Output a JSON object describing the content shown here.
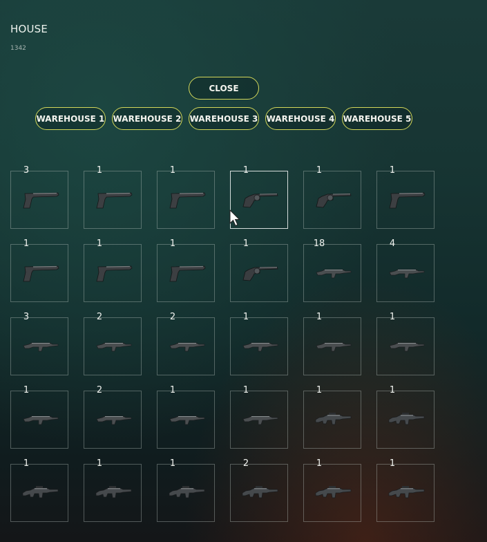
{
  "header": {
    "title": "HOUSE",
    "subtitle": "1342"
  },
  "buttons": {
    "close": "CLOSE",
    "warehouses": [
      "WAREHOUSE 1",
      "WAREHOUSE 2",
      "WAREHOUSE 3",
      "WAREHOUSE 4",
      "WAREHOUSE 5"
    ]
  },
  "accent_color": "#d4d85a",
  "inventory": {
    "slots": [
      {
        "count": "3",
        "icon": "pistol-icon"
      },
      {
        "count": "1",
        "icon": "pistol-icon"
      },
      {
        "count": "1",
        "icon": "pistol-icon"
      },
      {
        "count": "1",
        "icon": "revolver-icon"
      },
      {
        "count": "1",
        "icon": "revolver-icon"
      },
      {
        "count": "1",
        "icon": "pistol-icon"
      },
      {
        "count": "1",
        "icon": "pistol-icon"
      },
      {
        "count": "1",
        "icon": "pistol-icon"
      },
      {
        "count": "1",
        "icon": "pistol-icon"
      },
      {
        "count": "1",
        "icon": "revolver-icon"
      },
      {
        "count": "18",
        "icon": "smg-icon"
      },
      {
        "count": "4",
        "icon": "smg-icon"
      },
      {
        "count": "3",
        "icon": "smg-icon"
      },
      {
        "count": "2",
        "icon": "smg-icon"
      },
      {
        "count": "2",
        "icon": "smg-icon"
      },
      {
        "count": "1",
        "icon": "smg-icon"
      },
      {
        "count": "1",
        "icon": "smg-icon"
      },
      {
        "count": "1",
        "icon": "smg-icon"
      },
      {
        "count": "1",
        "icon": "smg-icon"
      },
      {
        "count": "2",
        "icon": "smg-icon"
      },
      {
        "count": "1",
        "icon": "smg-icon"
      },
      {
        "count": "1",
        "icon": "smg-icon"
      },
      {
        "count": "1",
        "icon": "rifle-icon"
      },
      {
        "count": "1",
        "icon": "rifle-icon"
      },
      {
        "count": "1",
        "icon": "rifle-icon"
      },
      {
        "count": "1",
        "icon": "rifle-icon"
      },
      {
        "count": "1",
        "icon": "rifle-icon"
      },
      {
        "count": "2",
        "icon": "rifle-icon"
      },
      {
        "count": "1",
        "icon": "rifle-icon"
      },
      {
        "count": "1",
        "icon": "rifle-icon"
      }
    ]
  }
}
